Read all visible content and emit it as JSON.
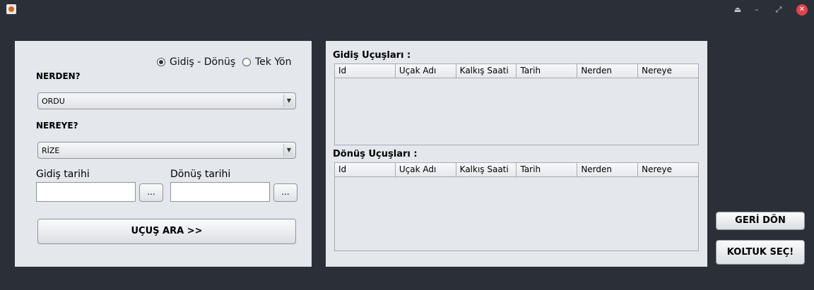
{
  "window": {
    "buttons": {
      "minimize_up": "⏏",
      "minimize": "–",
      "restore": "⤢",
      "close": "✕"
    }
  },
  "search": {
    "trip_type": {
      "options": [
        "Gidiş - Dönüş",
        "Tek Yön"
      ],
      "selected": "Gidiş - Dönüş"
    },
    "from_label": "NERDEN?",
    "from_value": "ORDU",
    "to_label": "NEREYE?",
    "to_value": "RİZE",
    "departure_label": "Gidiş tarihi",
    "return_label": "Dönüş tarihi",
    "departure_value": "",
    "return_value": "",
    "picker_label": "...",
    "search_button": "UÇUŞ ARA >>"
  },
  "flights": {
    "outbound_title": "Gidiş Uçuşları :",
    "return_title": "Dönüş Uçuşları :",
    "columns": [
      "Id",
      "Uçak Adı",
      "Kalkış Saati",
      "Tarih",
      "Nerden",
      "Nereye"
    ]
  },
  "actions": {
    "back": "GERİ DÖN",
    "select_seat": "KOLTUK SEÇ!"
  },
  "colors": {
    "background": "#2b2f38",
    "panel": "#e4e7ec",
    "close": "#e0444a"
  }
}
